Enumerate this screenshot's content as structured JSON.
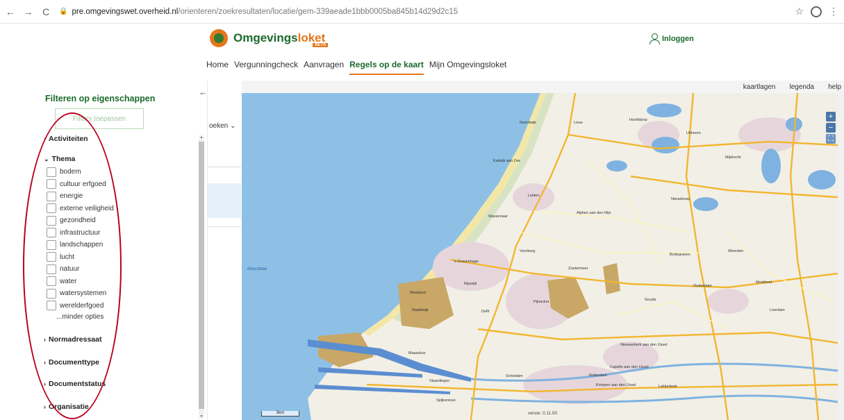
{
  "browser": {
    "back_icon": "arrow-left-icon",
    "url_host": "pre.omgevingswet.overheid.nl",
    "url_path": "/orienteren/zoekresultaten/locatie/gem-339aeade1bbb0005ba845b14d29d2c15"
  },
  "header": {
    "logo_part1": "Omgevings",
    "logo_part2": "loket",
    "beta": "BETA",
    "login_label": "Inloggen",
    "nav": [
      {
        "label": "Home"
      },
      {
        "label": "Vergunningcheck"
      },
      {
        "label": "Aanvragen"
      },
      {
        "label": "Regels op de kaart",
        "active": true
      },
      {
        "label": "Mijn Omgevingsloket"
      }
    ]
  },
  "filters": {
    "title": "Filteren op eigenschappen",
    "apply_button": "Filters toepassen",
    "sections": {
      "activiteiten": "Activiteiten",
      "thema": "Thema",
      "normadressaat": "Normadressaat",
      "documenttype": "Documenttype",
      "documentstatus": "Documentstatus",
      "organisatie": "Organisatie"
    },
    "thema_items": [
      "bodem",
      "cultuur erfgoed",
      "energie",
      "externe veiligheid",
      "gezondheid",
      "infrastructuur",
      "landschappen",
      "lucht",
      "natuur",
      "water",
      "watersystemen",
      "werelderfgoed"
    ],
    "minder_opties": "...minder opties"
  },
  "middle": {
    "zoeken_label": "oeken"
  },
  "map": {
    "toolbar": {
      "kaartlagen": "kaartlagen",
      "legenda": "legenda",
      "help": "help"
    },
    "zoom_in": "+",
    "zoom_out": "−",
    "scale": "5km",
    "version": "versie: 0.11.50",
    "labels": {
      "noordzee": "Noordzee",
      "den_haag": "'s-Gravenhage",
      "leiden": "Leiden",
      "delft": "Delft",
      "rotterdam": "Rotterdam",
      "gouda": "Gouda",
      "zoetermeer": "Zoetermeer",
      "alphen": "Alphen aan den Rijn",
      "woerden": "Woerden",
      "katwijk": "Katwijk aan Zee",
      "noordwijk": "Noordwijk",
      "lisse": "Lisse",
      "hoofddorp": "Hoofddorp",
      "uithoorn": "Uithoorn",
      "mijdrecht": "Mijdrecht",
      "wassenaar": "Wassenaar",
      "voorburg": "Voorburg",
      "rijswijk": "Rijswijk",
      "pijnacker": "Pijnacker",
      "westland": "Westland",
      "naaldwijk": "Naaldwijk",
      "maassluis": "Maassluis",
      "vlaardingen": "Vlaardingen",
      "schiedam": "Schiedam",
      "spijkenisse": "Spijkenisse",
      "capelle": "Capelle aan den IJssel",
      "krimpen": "Krimpen aan den IJssel",
      "nieuwerkerk": "Nieuwerkerk aan den IJssel",
      "bodegraven": "Bodegraven",
      "nieuwkoop": "Nieuwkoop",
      "leerdam": "Leerdam",
      "oudewater": "Oudewater",
      "montfoort": "Montfoort",
      "lekkerkerk": "Lekkerkerk"
    }
  }
}
